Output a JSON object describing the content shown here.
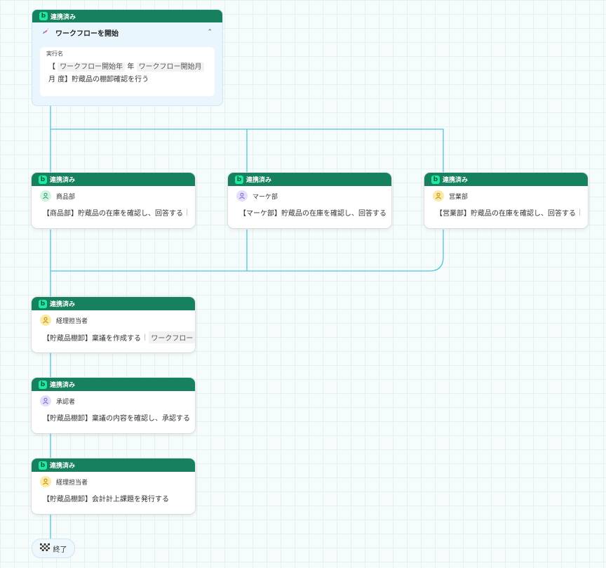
{
  "colors": {
    "header": "#17815f",
    "connector": "#4fc6de",
    "badge": "#1de9a0"
  },
  "start": {
    "status": "連携済み",
    "badge": "b",
    "icon": "rocket-icon",
    "title": "ワークフローを開始",
    "collapse_icon": "chevron-up-icon",
    "field_label": "実行名",
    "name_parts": {
      "open": "【",
      "var_year": "ワークフロー開始年",
      "year_unit": "年",
      "var_month": "ワークフロー開始月",
      "month_unit": "月",
      "rest": "度】貯蔵品の棚卸確認を行う"
    }
  },
  "nodes": [
    {
      "status": "連携済み",
      "badge": "b",
      "role": "商品部",
      "avatar": "person-icon",
      "task": "【商品部】貯蔵品の在庫を確認し、回答する",
      "tail": "|",
      "chip": ""
    },
    {
      "status": "連携済み",
      "badge": "b",
      "role": "マーケ部",
      "avatar": "person-icon",
      "task": "【マーケ部】貯蔵品の在庫を確認し、回答する",
      "tail": "",
      "chip": ""
    },
    {
      "status": "連携済み",
      "badge": "b",
      "role": "営業部",
      "avatar": "person-icon",
      "task": "【営業部】貯蔵品の在庫を確認し、回答する",
      "tail": "|",
      "chip": ""
    },
    {
      "status": "連携済み",
      "badge": "b",
      "role": "経理担当者",
      "avatar": "person-icon",
      "task": "【貯蔵品棚卸】稟議を作成する",
      "tail": "|",
      "chip": "ワークフロー"
    },
    {
      "status": "連携済み",
      "badge": "b",
      "role": "承認者",
      "avatar": "person-icon",
      "task": "【貯蔵品棚卸】稟議の内容を確認し、承認する",
      "tail": "",
      "chip": ""
    },
    {
      "status": "連携済み",
      "badge": "b",
      "role": "経理担当者",
      "avatar": "person-icon",
      "task": "【貯蔵品棚卸】会計計上課題を発行する",
      "tail": "",
      "chip": ""
    }
  ],
  "end": {
    "label": "終了",
    "icon": "checkered-flag-icon"
  }
}
